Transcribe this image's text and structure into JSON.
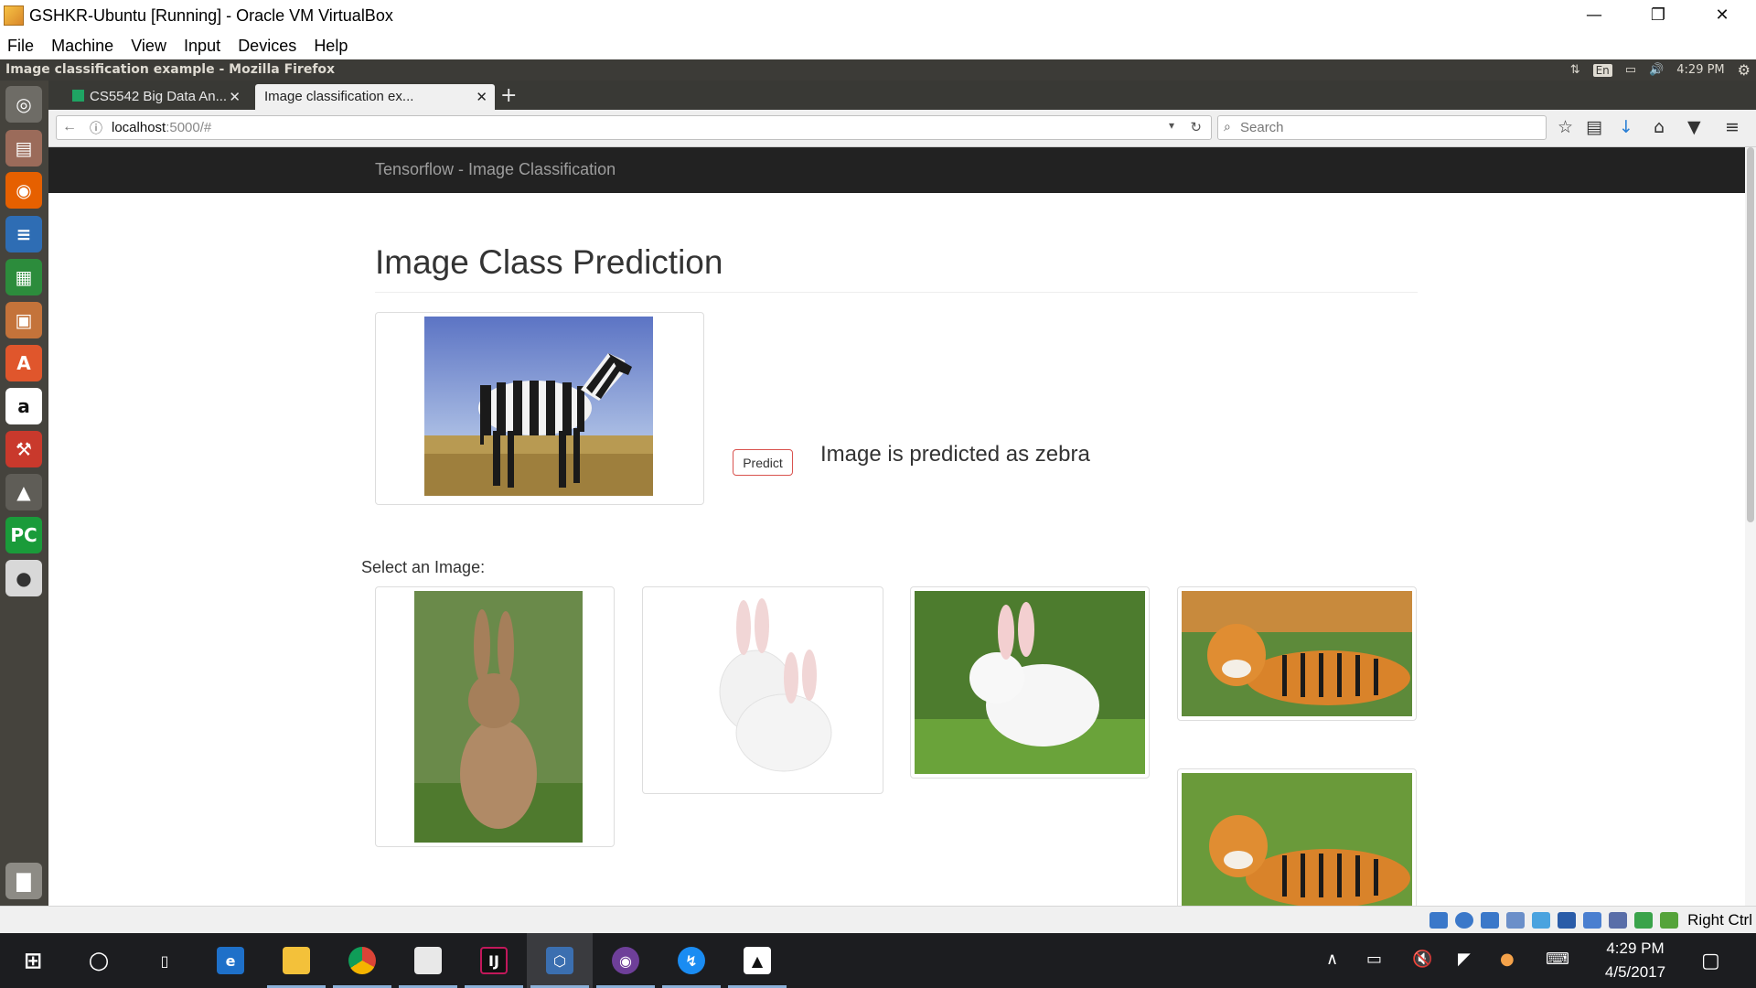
{
  "vbox": {
    "title": "GSHKR-Ubuntu [Running] - Oracle VM VirtualBox",
    "menu": [
      "File",
      "Machine",
      "View",
      "Input",
      "Devices",
      "Help"
    ],
    "host_key": "Right Ctrl"
  },
  "ubuntu": {
    "window_title": "Image classification example - Mozilla Firefox",
    "keyboard_layout": "En",
    "time": "4:29 PM"
  },
  "firefox": {
    "tabs": [
      {
        "label": "CS5542 Big Data An...",
        "active": false
      },
      {
        "label": "Image classification ex...",
        "active": true
      }
    ],
    "url_host": "localhost",
    "url_path": ":5000/#",
    "search_placeholder": "Search"
  },
  "page": {
    "brand": "Tensorflow - Image Classification",
    "heading": "Image Class Prediction",
    "predict_label": "Predict",
    "result_text": "Image is predicted as zebra",
    "select_label": "Select an Image:",
    "selected_image": "zebra",
    "gallery": [
      "rabbit",
      "two white rabbits",
      "white rabbit",
      "tiger",
      "tiger"
    ]
  },
  "windows": {
    "clock_time": "4:29 PM",
    "clock_date": "4/5/2017"
  },
  "colors": {
    "navbar_bg": "#222222",
    "predict_border": "#d9534f",
    "taskbar_bg": "#1c1d20",
    "ubuntu_panel": "#3c3b37"
  }
}
